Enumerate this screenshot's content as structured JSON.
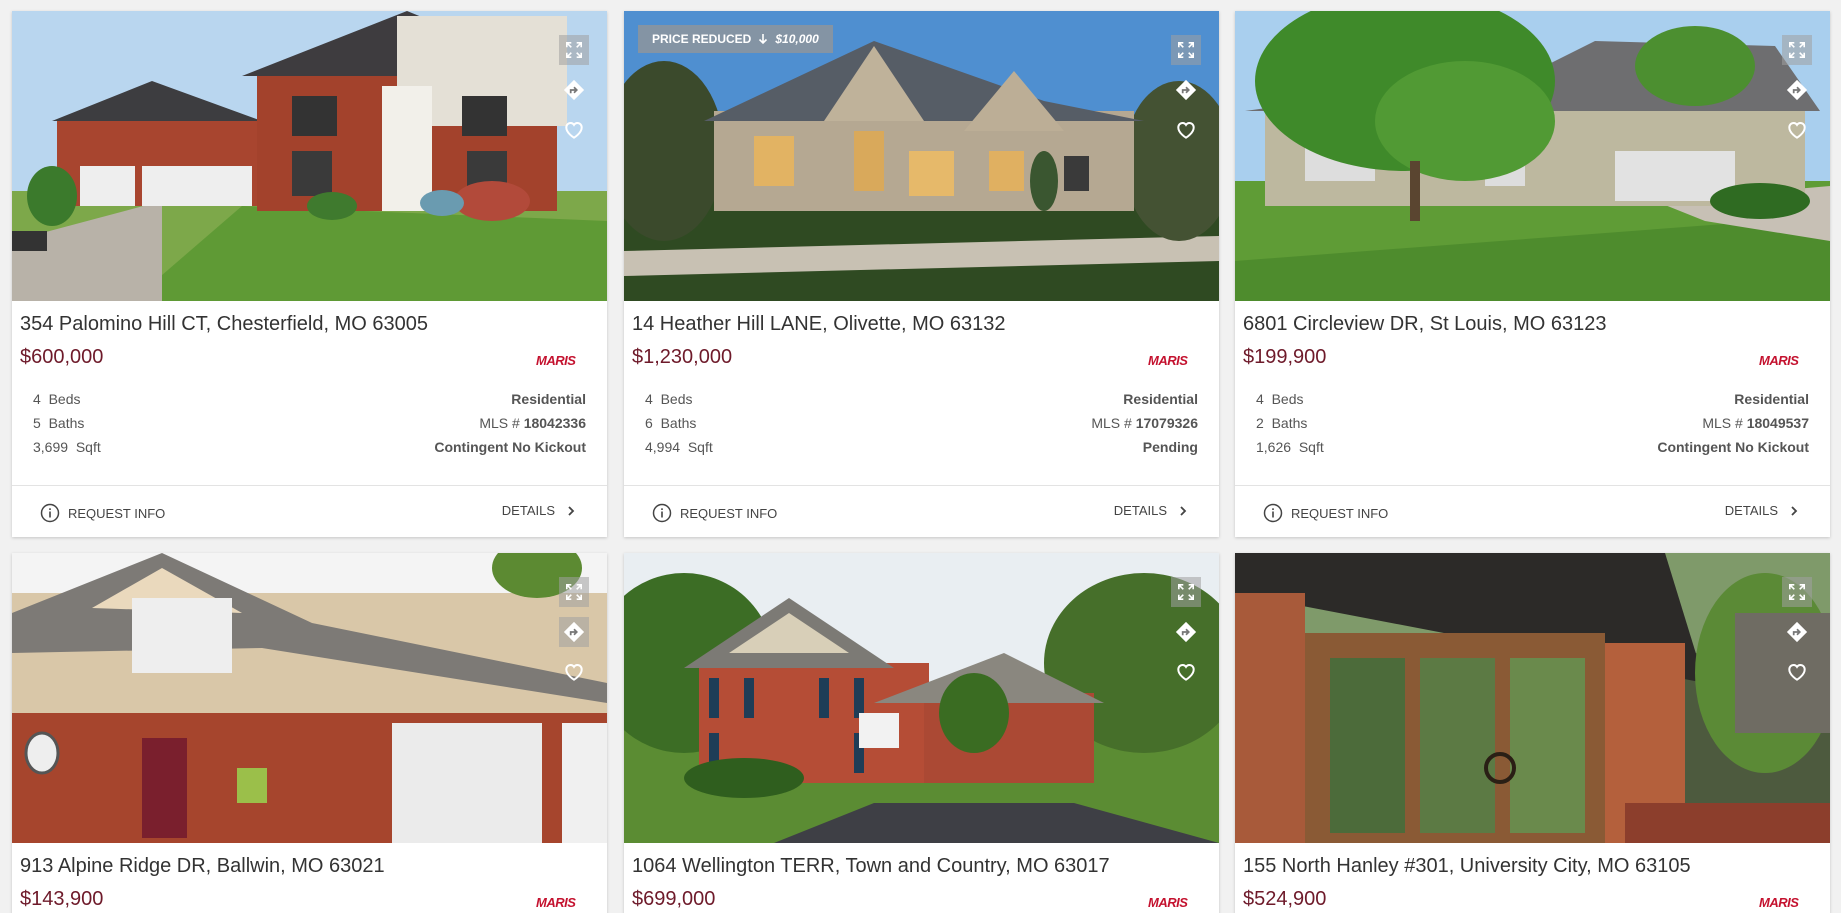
{
  "icons": {
    "expand": "expand-icon",
    "route": "directions-icon",
    "favorite": "heart-icon",
    "info": "info-icon",
    "chevron": "chevron-right-icon"
  },
  "colors": {
    "price": "#6e1a2a",
    "logo": "#c4122f"
  },
  "actions": {
    "request_info": "REQUEST INFO",
    "details": "DETAILS"
  },
  "listings": [
    {
      "address": "354 Palomino Hill CT, Chesterfield, MO 63005",
      "price": "$600,000",
      "logo": "MARIS",
      "beds": "4",
      "beds_label": "Beds",
      "baths": "5",
      "baths_label": "Baths",
      "sqft": "3,699",
      "sqft_label": "Sqft",
      "type": "Residential",
      "mls_label": "MLS #",
      "mls": "18042336",
      "status": "Contingent No Kickout"
    },
    {
      "address": "14 Heather Hill LANE, Olivette, MO 63132",
      "price": "$1,230,000",
      "logo": "MARIS",
      "badge_label": "PRICE REDUCED",
      "badge_amount": "$10,000",
      "beds": "4",
      "beds_label": "Beds",
      "baths": "6",
      "baths_label": "Baths",
      "sqft": "4,994",
      "sqft_label": "Sqft",
      "type": "Residential",
      "mls_label": "MLS #",
      "mls": "17079326",
      "status": "Pending"
    },
    {
      "address": "6801 Circleview DR, St Louis, MO 63123",
      "price": "$199,900",
      "logo": "MARIS",
      "beds": "4",
      "beds_label": "Beds",
      "baths": "2",
      "baths_label": "Baths",
      "sqft": "1,626",
      "sqft_label": "Sqft",
      "type": "Residential",
      "mls_label": "MLS #",
      "mls": "18049537",
      "status": "Contingent No Kickout"
    },
    {
      "address": "913 Alpine Ridge DR, Ballwin, MO 63021",
      "price": "$143,900",
      "logo": "MARIS"
    },
    {
      "address": "1064 Wellington TERR, Town and Country, MO 63017",
      "price": "$699,000",
      "logo": "MARIS"
    },
    {
      "address": "155 North Hanley #301, University City, MO 63105",
      "price": "$524,900",
      "logo": "MARIS"
    }
  ]
}
